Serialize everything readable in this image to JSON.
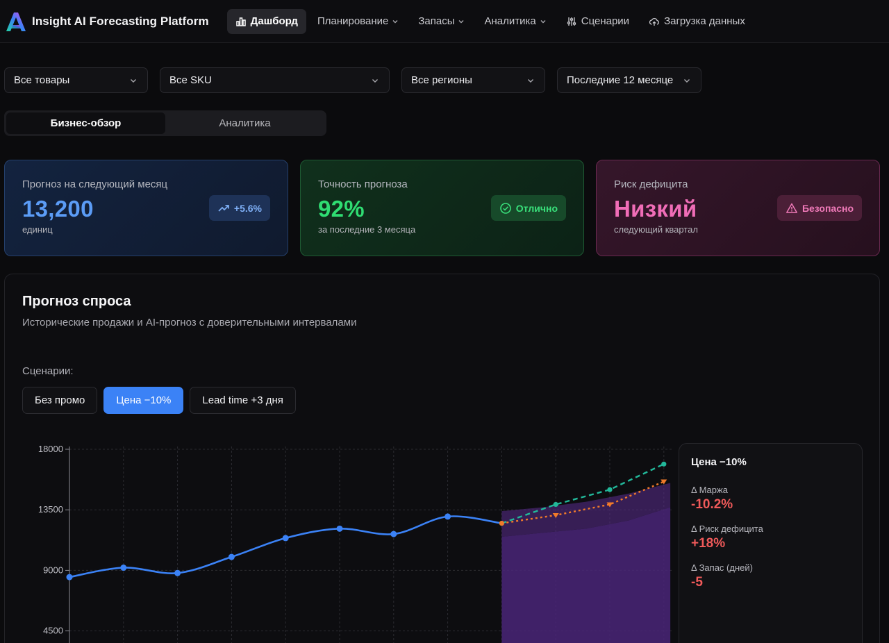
{
  "app": {
    "title": "Insight AI Forecasting Platform",
    "logo_letter": "A"
  },
  "nav": {
    "items": [
      {
        "label": "Дашборд",
        "icon": "bar-chart-icon",
        "active": true,
        "dropdown": false
      },
      {
        "label": "Планирование",
        "dropdown": true
      },
      {
        "label": "Запасы",
        "dropdown": true
      },
      {
        "label": "Аналитика",
        "dropdown": true
      },
      {
        "label": "Сценарии",
        "icon": "sliders-icon",
        "dropdown": false
      },
      {
        "label": "Загрузка данных",
        "icon": "cloud-upload-icon",
        "dropdown": false
      }
    ]
  },
  "filters": {
    "products": "Все товары",
    "sku": "Все SKU",
    "regions": "Все регионы",
    "period": "Последние 12 месяце"
  },
  "tabs": [
    {
      "label": "Бизнес-обзор",
      "active": true
    },
    {
      "label": "Аналитика",
      "active": false
    }
  ],
  "kpis": {
    "forecast": {
      "label": "Прогноз на следующий месяц",
      "value": "13,200",
      "sub": "единиц",
      "badge": "+5.6%",
      "color": "#5b9cf6"
    },
    "accuracy": {
      "label": "Точность прогноза",
      "value": "92%",
      "sub": "за последние 3 месяца",
      "badge": "Отлично",
      "color": "#2fdd72"
    },
    "risk": {
      "label": "Риск дефицита",
      "value": "Низкий",
      "sub": "следующий квартал",
      "badge": "Безопасно",
      "color": "#f06db7"
    }
  },
  "forecast_panel": {
    "title": "Прогноз спроса",
    "subtitle": "Исторические продажи и AI-прогноз с доверительными интервалами",
    "scenarios_label": "Сценарии:",
    "scenarios": [
      {
        "label": "Без промо",
        "active": false
      },
      {
        "label": "Цена −10%",
        "active": true
      },
      {
        "label": "Lead time +3 дня",
        "active": false
      }
    ],
    "side": {
      "title": "Цена −10%",
      "metrics": [
        {
          "label": "Δ Маржа",
          "value": "-10.2%"
        },
        {
          "label": "Δ Риск дефицита",
          "value": "+18%"
        },
        {
          "label": "Δ Запас (дней)",
          "value": "-5"
        }
      ]
    }
  },
  "chart_data": {
    "type": "line",
    "ylim": [
      0,
      18000
    ],
    "yticks": [
      4500,
      9000,
      13500,
      18000
    ],
    "grid": true,
    "history": {
      "color": "#3b82f6",
      "values": [
        8500,
        9200,
        8800,
        10000,
        11400,
        12100,
        11700,
        13000,
        12500
      ]
    },
    "forecast_start_index": 8,
    "confidence_band": {
      "color": "#5b2d8e",
      "upper": [
        13400,
        13700,
        14100,
        14700,
        15500
      ],
      "lower": [
        11500,
        11800,
        12100,
        12700,
        13700
      ]
    },
    "series": [
      {
        "style": "dashed",
        "color": "#22b89a",
        "values": [
          12500,
          13900,
          15000,
          16900
        ]
      },
      {
        "style": "dotted",
        "color": "#f07a2a",
        "values": [
          12500,
          13100,
          13900,
          15600
        ]
      }
    ]
  }
}
